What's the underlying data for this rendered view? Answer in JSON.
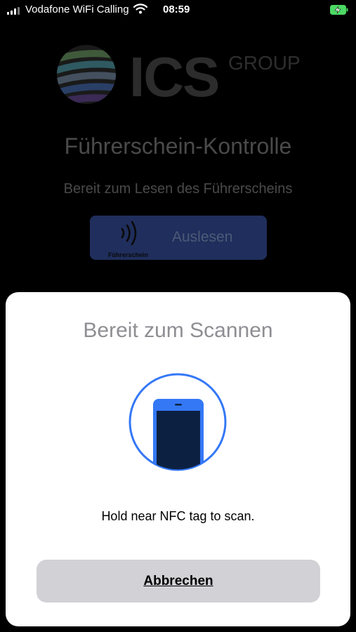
{
  "status_bar": {
    "carrier": "Vodafone WiFi Calling",
    "time": "08:59",
    "signal_icon": "signal-bars-icon",
    "wifi_icon": "wifi-icon",
    "battery_icon": "battery-charging-icon"
  },
  "background_screen": {
    "logo": {
      "mark": "ICS",
      "suffix": "GROUP"
    },
    "title": "Führerschein-Kontrolle",
    "subtitle": "Bereit zum Lesen des Führerscheins",
    "read_button": {
      "icon": "nfc-waves-icon",
      "icon_caption": "Führerschein",
      "label": "Auslesen",
      "color": "#1f2e5c"
    }
  },
  "scan_sheet": {
    "title": "Bereit zum Scannen",
    "graphic_icon": "phone-scan-icon",
    "instruction": "Hold near NFC tag to scan.",
    "cancel_label": "Abbrechen",
    "accent_color": "#3478f6"
  }
}
